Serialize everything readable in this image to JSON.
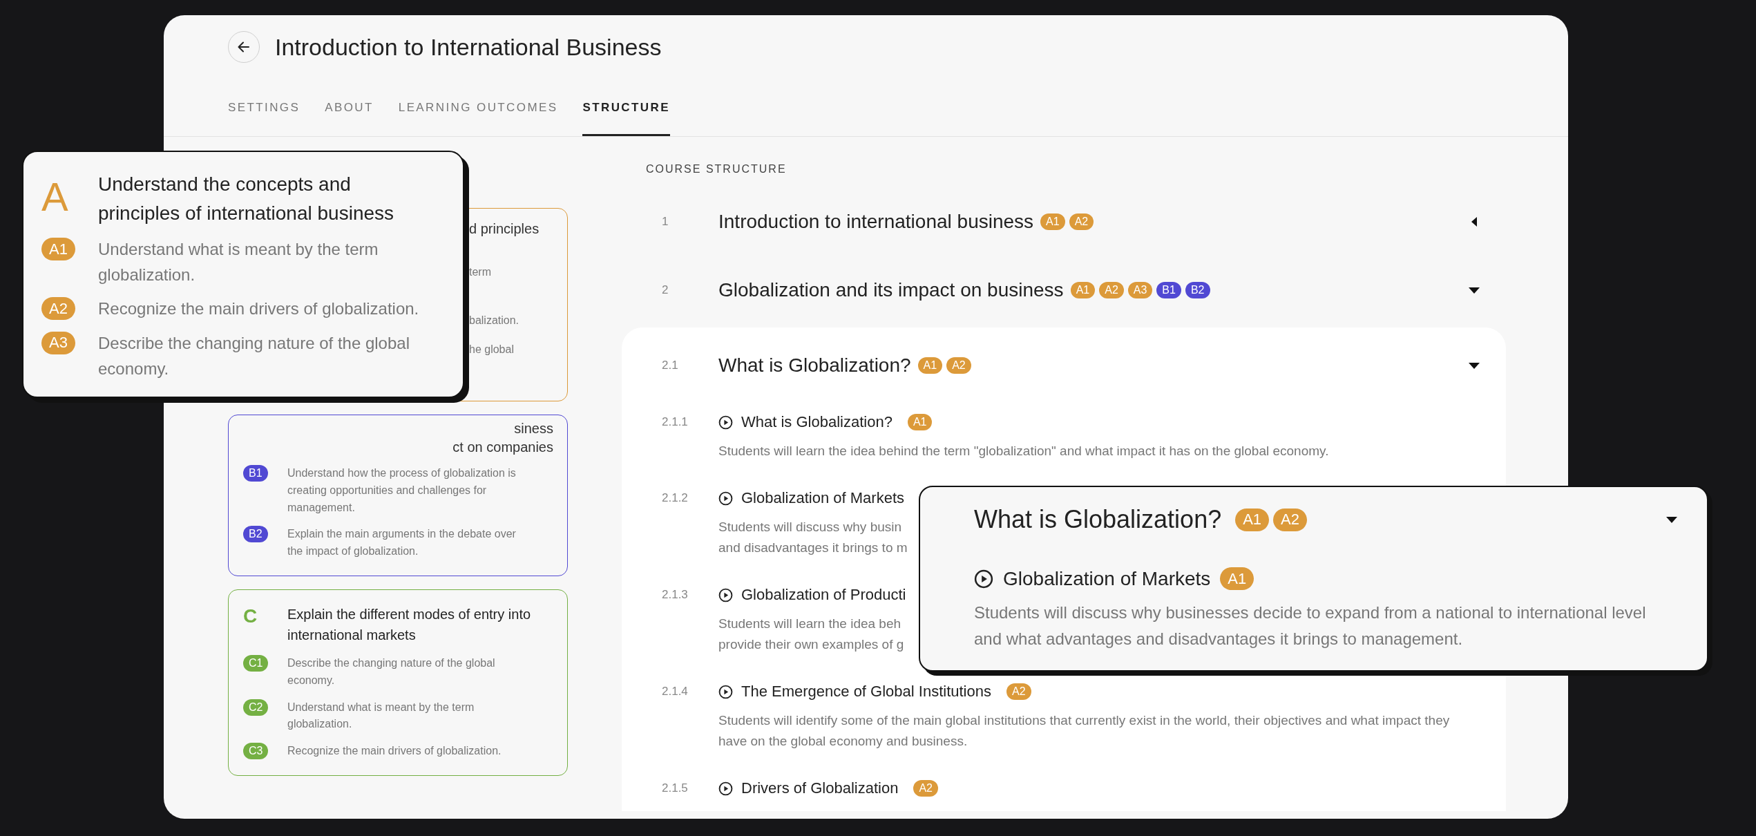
{
  "header": {
    "title": "Introduction to International Business"
  },
  "tabs": [
    {
      "label": "SETTINGS",
      "selected": false
    },
    {
      "label": "ABOUT",
      "selected": false
    },
    {
      "label": "LEARNING OUTCOMES",
      "selected": false
    },
    {
      "label": "STRUCTURE",
      "selected": true
    }
  ],
  "outcome_cards": [
    {
      "kind": "covered",
      "color": "#dc9a3a",
      "fragments": [
        "d principles",
        "term",
        "balization.",
        "he global"
      ]
    },
    {
      "kind": "partial",
      "color": "#5149d3",
      "title_fragments": [
        "siness",
        "ct on companies"
      ],
      "items": [
        {
          "code": "B1",
          "text": "Understand how the process of globalization is creating opportunities and challenges for management."
        },
        {
          "code": "B2",
          "text": "Explain the main arguments in the debate over the impact of globalization."
        }
      ]
    },
    {
      "kind": "full",
      "color": "#74b043",
      "letter": "C",
      "title": "Explain the different modes of entry into international markets",
      "items": [
        {
          "code": "C1",
          "text": "Describe the changing nature of the global economy."
        },
        {
          "code": "C2",
          "text": "Understand what is meant by the term globalization."
        },
        {
          "code": "C3",
          "text": "Recognize the main drivers of globalization."
        }
      ]
    }
  ],
  "structure": {
    "heading": "COURSE STRUCTURE",
    "sections": [
      {
        "number": "1",
        "title": "Introduction to international business",
        "expanded": false,
        "badges": [
          {
            "code": "A1",
            "color": "#dc9a3a"
          },
          {
            "code": "A2",
            "color": "#dc9a3a"
          }
        ]
      },
      {
        "number": "2",
        "title": "Globalization and its impact on business",
        "expanded": true,
        "badges": [
          {
            "code": "A1",
            "color": "#dc9a3a"
          },
          {
            "code": "A2",
            "color": "#dc9a3a"
          },
          {
            "code": "A3",
            "color": "#dc9a3a"
          },
          {
            "code": "B1",
            "color": "#5149d3"
          },
          {
            "code": "B2",
            "color": "#5149d3"
          }
        ]
      }
    ],
    "module": {
      "number": "2.1",
      "title": "What is Globalization?",
      "expanded": true,
      "badges": [
        {
          "code": "A1",
          "color": "#dc9a3a"
        },
        {
          "code": "A2",
          "color": "#dc9a3a"
        }
      ],
      "lessons": [
        {
          "number": "2.1.1",
          "title": "What is Globalization?",
          "badges": [
            {
              "code": "A1",
              "color": "#dc9a3a"
            }
          ],
          "description": "Students will learn the idea behind the term \"globalization\" and what impact it has on the global economy."
        },
        {
          "number": "2.1.2",
          "title": "Globalization of Markets",
          "description_fragments": [
            "Students will discuss why busin",
            "and disadvantages it brings to m"
          ]
        },
        {
          "number": "2.1.3",
          "title": "Globalization of Producti",
          "description_fragments": [
            "Students will learn the idea beh",
            "provide their own examples of g"
          ]
        },
        {
          "number": "2.1.4",
          "title": "The Emergence of Global Institutions",
          "badges": [
            {
              "code": "A2",
              "color": "#dc9a3a"
            }
          ],
          "description": "Students will identify some of the main global institutions that currently exist in the world, their objectives and what impact they have on the global economy and business."
        },
        {
          "number": "2.1.5",
          "title": "Drivers of Globalization",
          "badges": [
            {
              "code": "A2",
              "color": "#dc9a3a"
            }
          ]
        }
      ]
    }
  },
  "outcome_popup": {
    "letter": "A",
    "color": "#dc9a3a",
    "title": "Understand the concepts and principles of international business",
    "items": [
      {
        "code": "A1",
        "text": "Understand what is meant by the term globalization."
      },
      {
        "code": "A2",
        "text": "Recognize the main drivers of globalization."
      },
      {
        "code": "A3",
        "text": "Describe the changing nature of the global economy."
      }
    ]
  },
  "lesson_popup": {
    "title": "What is Globalization?",
    "expanded": true,
    "badges": [
      {
        "code": "A1",
        "color": "#dc9a3a"
      },
      {
        "code": "A2",
        "color": "#dc9a3a"
      }
    ],
    "lesson": {
      "title": "Globalization of Markets",
      "badges": [
        {
          "code": "A1",
          "color": "#dc9a3a"
        }
      ],
      "description": "Students will discuss why businesses decide to expand from a national to international level and what advantages and disadvantages it brings to management."
    }
  }
}
